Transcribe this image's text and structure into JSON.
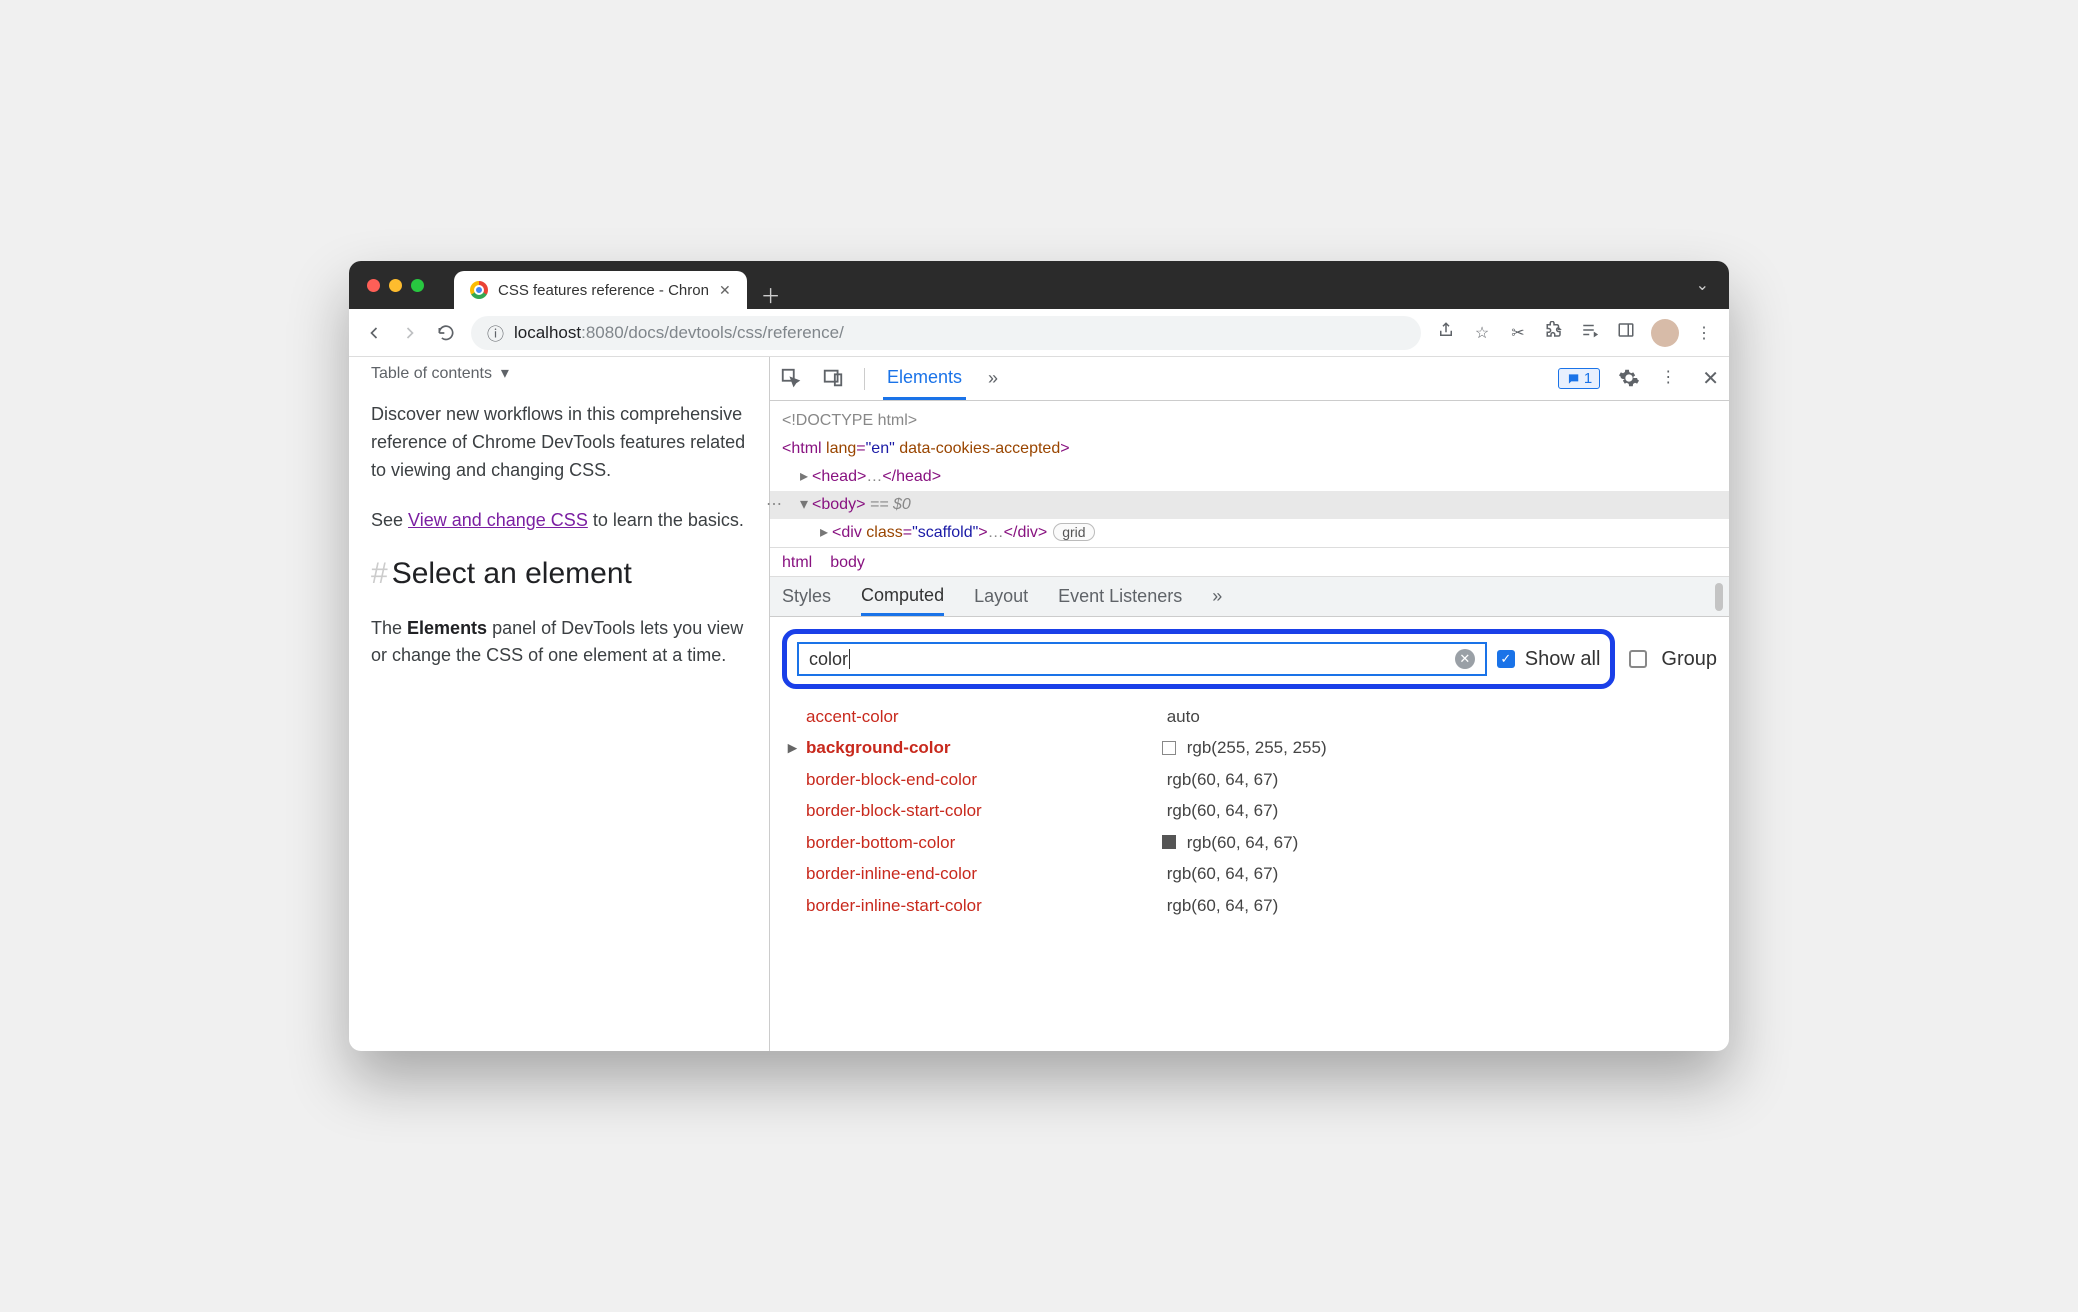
{
  "browser": {
    "tab_title": "CSS features reference - Chron",
    "url_prefix": "localhost",
    "url_port": ":8080",
    "url_path": "/docs/devtools/css/reference/"
  },
  "page": {
    "toc": "Table of contents",
    "p1_a": "Discover new workflows in this comprehensive reference of Chrome DevTools features related to viewing and changing CSS.",
    "p2_a": "See ",
    "p2_link": "View and change CSS",
    "p2_b": " to learn the basics.",
    "h2": "Select an element",
    "p3_a": "The ",
    "p3_b": "Elements",
    "p3_c": " panel of DevTools lets you view or change the CSS of one element at a time."
  },
  "devtools": {
    "tabs": {
      "elements": "Elements",
      "more": "»",
      "badge_count": "1"
    },
    "dom": {
      "doctype": "<!DOCTYPE html>",
      "html_open": "html",
      "html_attr": "lang",
      "html_val": "\"en\"",
      "html_attr2": "data-cookies-accepted",
      "head": "head",
      "ellipsis": "…",
      "body": "body",
      "sel": " == $0",
      "div": "div",
      "div_attr": "class",
      "div_val": "\"scaffold\"",
      "grid": "grid"
    },
    "crumbs": [
      "html",
      "body"
    ],
    "subtabs": [
      "Styles",
      "Computed",
      "Layout",
      "Event Listeners",
      "»"
    ],
    "filter": "color",
    "showall": "Show all",
    "group": "Group",
    "props": [
      {
        "n": "accent-color",
        "v": "auto",
        "e": false,
        "sw": 0,
        "b": false
      },
      {
        "n": "background-color",
        "v": "rgb(255, 255, 255)",
        "e": true,
        "sw": 1,
        "b": true
      },
      {
        "n": "border-block-end-color",
        "v": "rgb(60, 64, 67)",
        "e": false,
        "sw": 0,
        "b": false
      },
      {
        "n": "border-block-start-color",
        "v": "rgb(60, 64, 67)",
        "e": false,
        "sw": 0,
        "b": false
      },
      {
        "n": "border-bottom-color",
        "v": "rgb(60, 64, 67)",
        "e": false,
        "sw": 2,
        "b": false
      },
      {
        "n": "border-inline-end-color",
        "v": "rgb(60, 64, 67)",
        "e": false,
        "sw": 0,
        "b": false
      },
      {
        "n": "border-inline-start-color",
        "v": "rgb(60, 64, 67)",
        "e": false,
        "sw": 0,
        "b": false
      }
    ]
  }
}
